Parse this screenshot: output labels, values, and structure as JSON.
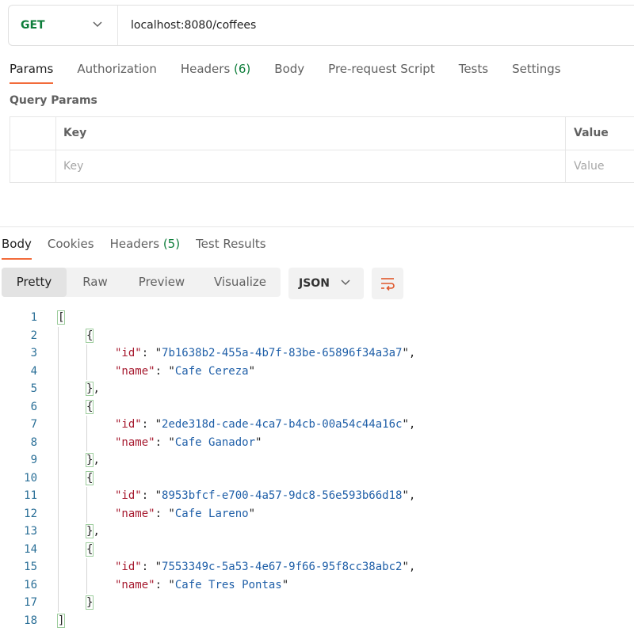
{
  "request": {
    "method": "GET",
    "url": "localhost:8080/coffees"
  },
  "request_tabs": [
    {
      "label": "Params",
      "count": ""
    },
    {
      "label": "Authorization",
      "count": ""
    },
    {
      "label": "Headers ",
      "count": "(6)"
    },
    {
      "label": "Body",
      "count": ""
    },
    {
      "label": "Pre-request Script",
      "count": ""
    },
    {
      "label": "Tests",
      "count": ""
    },
    {
      "label": "Settings",
      "count": ""
    }
  ],
  "query_params": {
    "title": "Query Params",
    "col_key": "Key",
    "col_value": "Value",
    "key_placeholder": "Key",
    "value_placeholder": "Value"
  },
  "response_tabs": [
    {
      "label": "Body",
      "count": ""
    },
    {
      "label": "Cookies",
      "count": ""
    },
    {
      "label": "Headers ",
      "count": "(5)"
    },
    {
      "label": "Test Results",
      "count": ""
    }
  ],
  "view_modes": [
    "Pretty",
    "Raw",
    "Preview",
    "Visualize"
  ],
  "format": "JSON",
  "colors": {
    "accent": "#f26b3a",
    "method_get": "#0d7d3a",
    "json_key": "#a6192e",
    "json_string": "#1f5fa8",
    "line_number": "#2a6f97"
  },
  "response_body": {
    "items": [
      {
        "id": "7b1638b2-455a-4b7f-83be-65896f34a3a7",
        "name": "Cafe Cereza"
      },
      {
        "id": "2ede318d-cade-4ca7-b4cb-00a54c44a16c",
        "name": "Cafe Ganador"
      },
      {
        "id": "8953bfcf-e700-4a57-9dc8-56e593b66d18",
        "name": "Cafe Lareno"
      },
      {
        "id": "7553349c-5a53-4e67-9f66-95f8cc38abc2",
        "name": "Cafe Tres Pontas"
      }
    ]
  }
}
